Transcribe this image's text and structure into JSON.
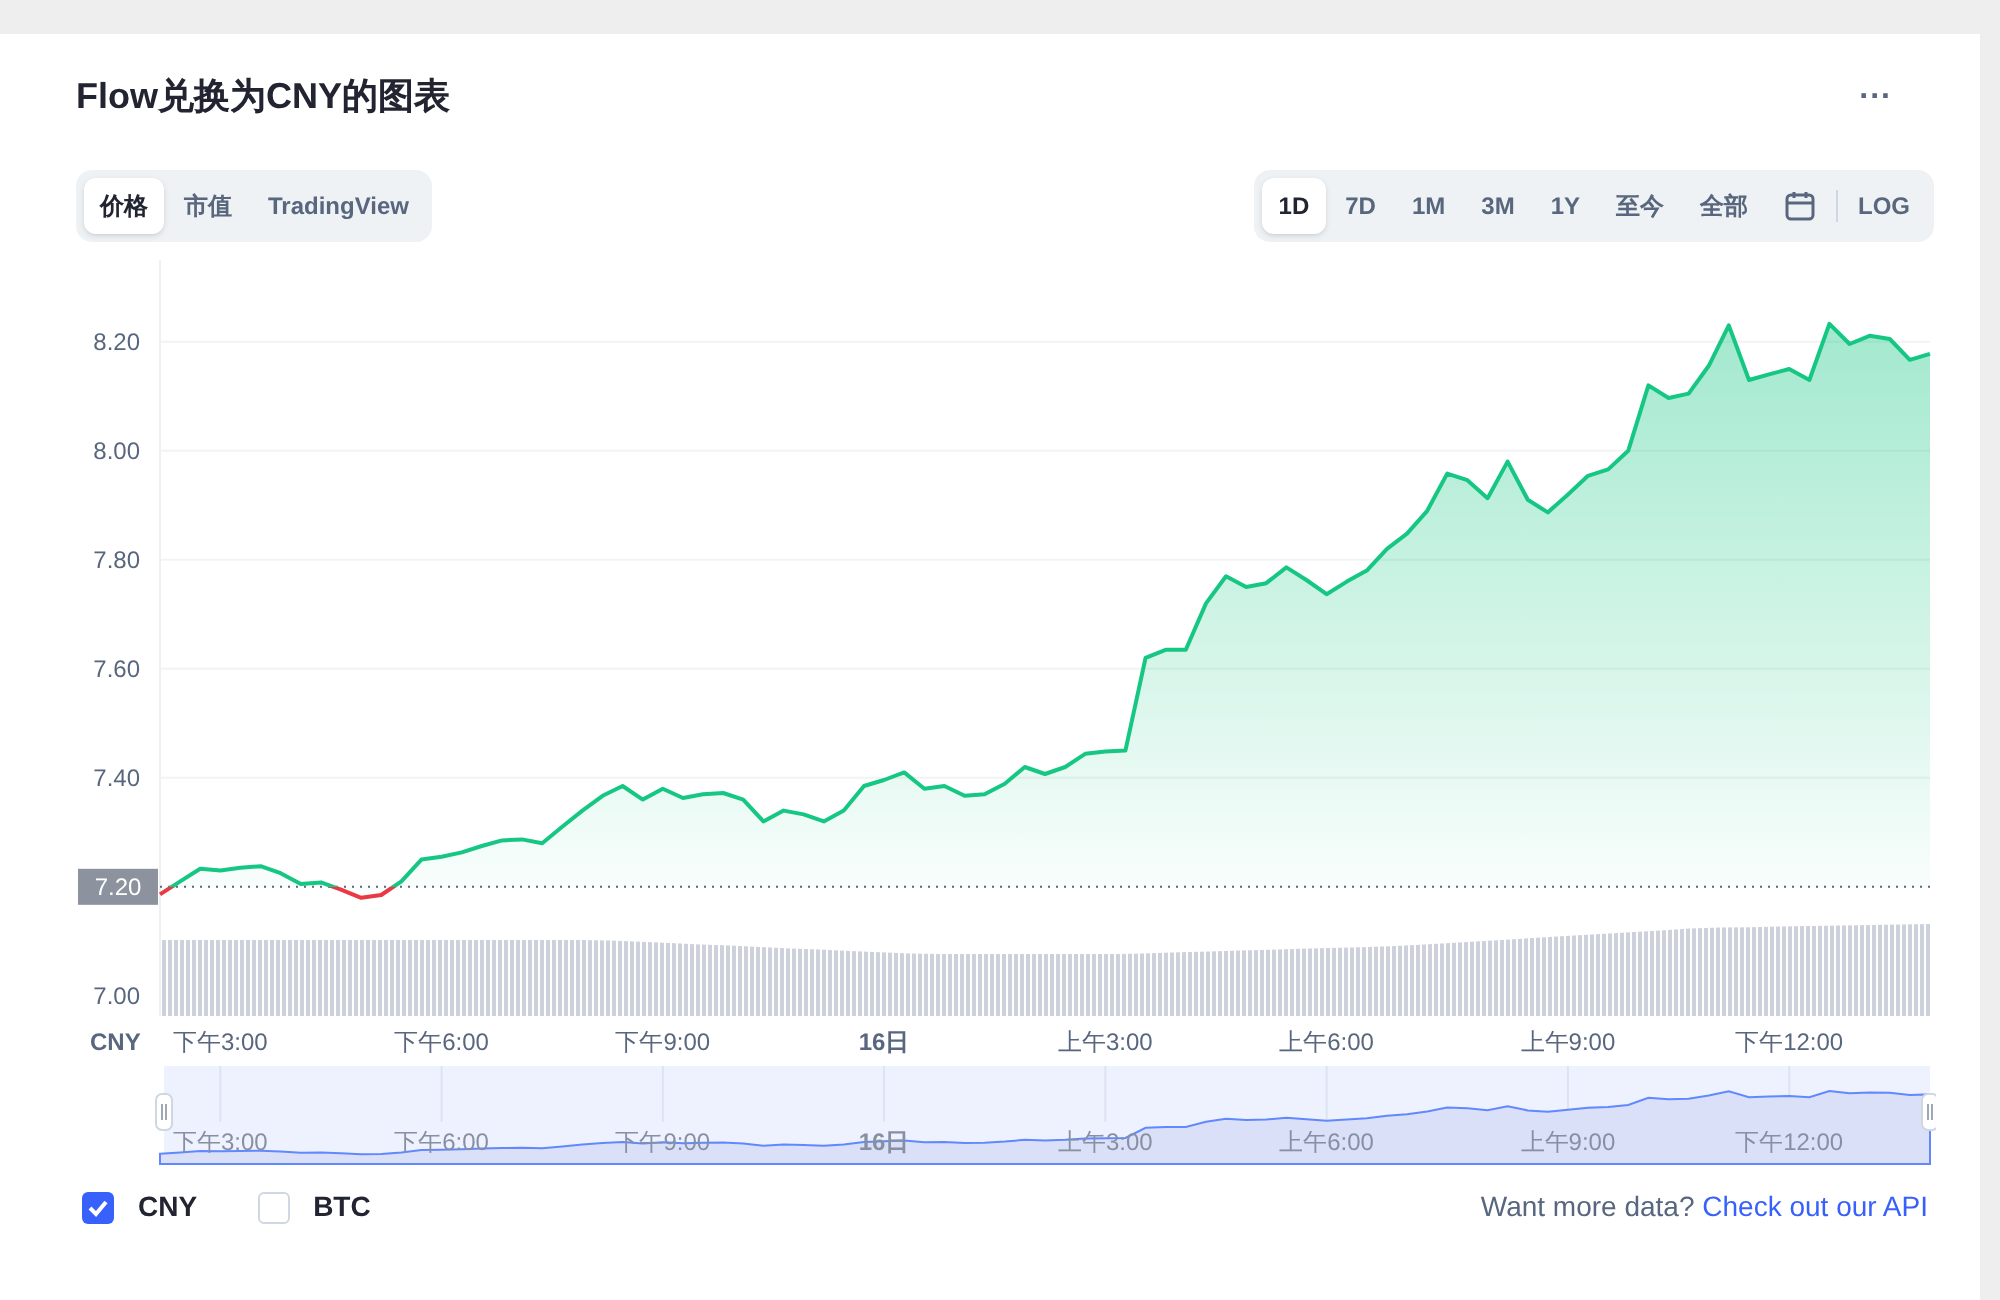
{
  "title": "Flow兑换为CNY的图表",
  "more_button": "...",
  "view_tabs": [
    {
      "label": "价格",
      "selected": true
    },
    {
      "label": "市值",
      "selected": false
    },
    {
      "label": "TradingView",
      "selected": false
    }
  ],
  "range_tabs": [
    {
      "label": "1D",
      "selected": true
    },
    {
      "label": "7D",
      "selected": false
    },
    {
      "label": "1M",
      "selected": false
    },
    {
      "label": "3M",
      "selected": false
    },
    {
      "label": "1Y",
      "selected": false
    },
    {
      "label": "至今",
      "selected": false
    },
    {
      "label": "全部",
      "selected": false
    }
  ],
  "log_button": "LOG",
  "chart": {
    "currency_label": "CNY",
    "chart_data": {
      "type": "area",
      "grid": true,
      "ylim": [
        6.963,
        8.35
      ],
      "yticks": [
        {
          "value": 7.0,
          "label": "7.00"
        },
        {
          "value": 7.4,
          "label": "7.40"
        },
        {
          "value": 7.6,
          "label": "7.60"
        },
        {
          "value": 7.8,
          "label": "7.80"
        },
        {
          "value": 8.0,
          "label": "8.00"
        },
        {
          "value": 8.2,
          "label": "8.20"
        }
      ],
      "categories": [
        null,
        null,
        null,
        "下午3:00",
        null,
        null,
        null,
        null,
        null,
        null,
        null,
        null,
        null,
        null,
        "下午6:00",
        null,
        null,
        null,
        null,
        null,
        null,
        null,
        null,
        null,
        null,
        "下午9:00",
        null,
        null,
        null,
        null,
        null,
        null,
        null,
        null,
        null,
        null,
        "16日",
        null,
        null,
        null,
        null,
        null,
        null,
        null,
        null,
        null,
        null,
        "上午3:00",
        null,
        null,
        null,
        null,
        null,
        null,
        null,
        null,
        null,
        null,
        "上午6:00",
        null,
        null,
        null,
        null,
        null,
        null,
        null,
        null,
        null,
        null,
        null,
        "上午9:00",
        null,
        null,
        null,
        null,
        null,
        null,
        null,
        null,
        null,
        null,
        "下午12:00",
        null,
        null,
        null,
        null,
        null,
        null,
        null
      ],
      "series": [
        {
          "color": "#16c784",
          "values": [
            7.186,
            7.21,
            7.233,
            7.23,
            7.235,
            7.238,
            7.225,
            7.205,
            7.208,
            7.195,
            7.18,
            7.185,
            7.21,
            7.25,
            7.255,
            7.263,
            7.275,
            7.285,
            7.287,
            7.28,
            7.31,
            7.34,
            7.367,
            7.385,
            7.36,
            7.38,
            7.363,
            7.37,
            7.372,
            7.36,
            7.32,
            7.34,
            7.333,
            7.32,
            7.34,
            7.385,
            7.396,
            7.41,
            7.38,
            7.385,
            7.367,
            7.37,
            7.389,
            7.42,
            7.407,
            7.42,
            7.444,
            7.448,
            7.45,
            7.62,
            7.635,
            7.635,
            7.72,
            7.77,
            7.75,
            7.757,
            7.786,
            7.763,
            7.737,
            7.76,
            7.78,
            7.82,
            7.848,
            7.89,
            7.958,
            7.946,
            7.913,
            7.98,
            7.91,
            7.887,
            7.92,
            7.954,
            7.966,
            8.0,
            8.12,
            8.097,
            8.105,
            8.156,
            8.23,
            8.13,
            8.14,
            8.15,
            8.13,
            8.233,
            8.196,
            8.211,
            8.205,
            8.167,
            8.178
          ]
        }
      ],
      "ref_lines": [
        {
          "axis": "y",
          "value": 7.2,
          "label": "7.20"
        }
      ]
    },
    "navigator_labels": [
      "下午3:00",
      "下午6:00",
      "下午9:00",
      "16日",
      "上午3:00",
      "上午6:00",
      "上午9:00",
      "下午12:00"
    ]
  },
  "legend": [
    {
      "label": "CNY",
      "checked": true
    },
    {
      "label": "BTC",
      "checked": false
    }
  ],
  "footer": {
    "text": "Want more data?",
    "link": "Check out our API"
  }
}
